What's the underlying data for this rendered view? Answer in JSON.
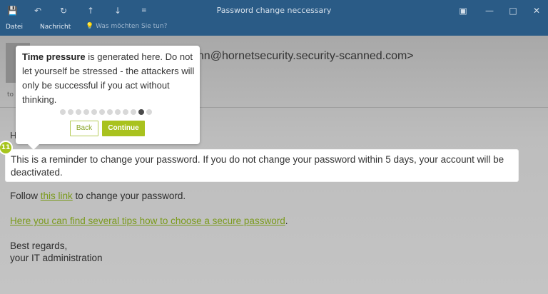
{
  "window": {
    "title": "Password change neccessary",
    "toolbar_icons": [
      "save-icon",
      "undo-icon",
      "redo-icon",
      "arrow-up-icon",
      "arrow-down-icon",
      "customize-icon"
    ]
  },
  "ribbon": {
    "tabs": [
      "Datei",
      "Nachricht"
    ],
    "search_placeholder": "Was möchten Sie tun?"
  },
  "email": {
    "sender": "ann@hornetsecurity.security-scanned.com>",
    "to_label": "to",
    "greeting": "H",
    "highlighted_paragraph": "This is a reminder to change your password. If you do not change your password within 5 days, your account will be deactivated.",
    "follow_prefix": "Follow ",
    "follow_link": "this link",
    "follow_suffix": " to change your password.",
    "tips_link": "Here you can find several tips how to choose a secure password",
    "tips_suffix": ".",
    "regards": "Best regards,",
    "signature": "your IT administration"
  },
  "tour": {
    "step_number": "11",
    "tooltip_bold": "Time pressure",
    "tooltip_text": " is generated here. Do not let yourself be stressed - the attackers will only be successful if you act without thinking.",
    "total_steps": 12,
    "current_step": 11,
    "back_label": "Back",
    "continue_label": "Continue"
  },
  "colors": {
    "titlebar": "#2a5b86",
    "accent": "#a9c21e",
    "link": "#7a9a1b"
  }
}
